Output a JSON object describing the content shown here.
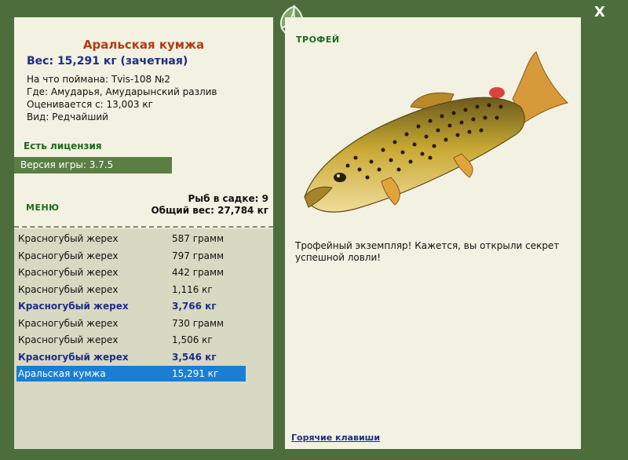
{
  "window": {
    "close_label": "X"
  },
  "fish": {
    "name": "Аральская кумжа",
    "weight_line": "Вес: 15,291 кг (зачетная)",
    "caught_on": "На что поймана: Tvis-108 №2",
    "location": "Где: Амударья, Амударынский разлив",
    "valued_from": "Оценивается с: 13,003 кг",
    "kind": "Вид: Редчайший"
  },
  "license": "Есть лицензия",
  "version": "Версия игры: 3.7.5",
  "menu_label": "МЕНЮ",
  "stats": {
    "count": "Рыб в садке: 9",
    "total": "Общий вес: 27,784 кг"
  },
  "catch_list": [
    {
      "name": "Красногубый жерех",
      "weight": "587 грамм",
      "style": "normal"
    },
    {
      "name": "Красногубый жерех",
      "weight": "797 грамм",
      "style": "normal"
    },
    {
      "name": "Красногубый жерех",
      "weight": "442 грамм",
      "style": "normal"
    },
    {
      "name": "Красногубый жерех",
      "weight": "1,116 кг",
      "style": "normal"
    },
    {
      "name": "Красногубый жерех",
      "weight": "3,766 кг",
      "style": "bold"
    },
    {
      "name": "Красногубый жерех",
      "weight": "730 грамм",
      "style": "normal"
    },
    {
      "name": "Красногубый жерех",
      "weight": "1,506 кг",
      "style": "normal"
    },
    {
      "name": "Красногубый жерех",
      "weight": "3,546 кг",
      "style": "bold"
    },
    {
      "name": "Аральская кумжа",
      "weight": "15,291 кг",
      "style": "selected"
    }
  ],
  "trophy": {
    "label": "ТРОФЕЙ",
    "text": "Трофейный экземпляр! Кажется, вы открыли секрет успешной ловли!"
  },
  "hotkeys": "Горячие клавиши"
}
